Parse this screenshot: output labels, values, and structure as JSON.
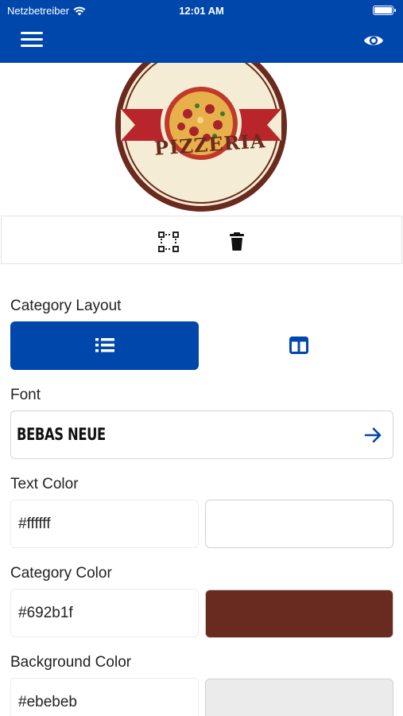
{
  "status_bar": {
    "carrier": "Netzbetreiber",
    "time": "12:01 AM"
  },
  "navbar": {
    "menu_icon": "hamburger-menu-icon",
    "preview_icon": "eye-icon"
  },
  "logo": {
    "text": "PIZZERIA",
    "ring_color": "#6b2a1e",
    "band_color": "#b8262b",
    "bg_color": "#f4ecd4"
  },
  "image_toolbar": {
    "crop_icon": "crop-selection-icon",
    "delete_icon": "trash-icon"
  },
  "category_layout": {
    "label": "Category Layout",
    "options": [
      {
        "name": "list",
        "icon": "list-icon",
        "selected": true
      },
      {
        "name": "grid",
        "icon": "grid-layout-icon",
        "selected": false
      }
    ]
  },
  "font": {
    "label": "Font",
    "value": "BEBAS NEUE",
    "icon": "arrow-right-icon"
  },
  "text_color": {
    "label": "Text Color",
    "value": "#ffffff",
    "swatch": "#ffffff"
  },
  "category_color": {
    "label": "Category Color",
    "value": "#692b1f",
    "swatch": "#692b1f"
  },
  "background_color": {
    "label": "Background Color",
    "value": "#ebebeb",
    "swatch": "#ebebeb"
  },
  "accent_color": "#0047ab"
}
